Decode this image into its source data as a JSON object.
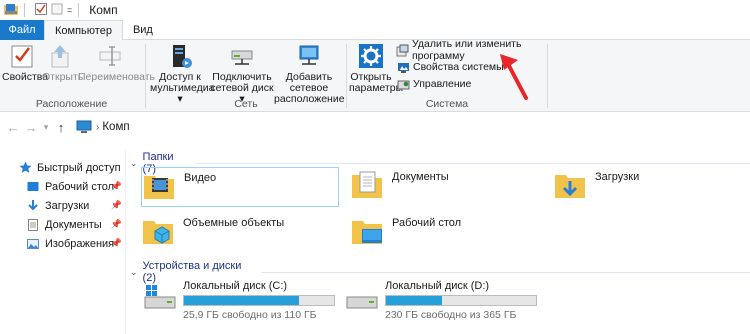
{
  "window": {
    "title": "Комп"
  },
  "tabs": [
    {
      "label": "Файл"
    },
    {
      "label": "Компьютер"
    },
    {
      "label": "Вид"
    }
  ],
  "ribbon": {
    "location_group": {
      "label": "Расположение",
      "properties": "Свойства",
      "open": "Открыть",
      "rename": "Переименовать"
    },
    "network_group": {
      "label": "Сеть",
      "media_access": [
        "Доступ к",
        "мультимедиа ▾"
      ],
      "map_drive": [
        "Подключить",
        "сетевой диск ▾"
      ],
      "add_location": [
        "Добавить сетевое",
        "расположение"
      ]
    },
    "system_group": {
      "label": "Система",
      "open_settings": [
        "Открыть",
        "параметры"
      ],
      "uninstall": "Удалить или изменить программу",
      "system_properties": "Свойства системы",
      "manage": "Управление"
    }
  },
  "address": {
    "crumb": "Комп"
  },
  "sidebar": {
    "items": [
      {
        "label": "Быстрый доступ",
        "pinned": false
      },
      {
        "label": "Рабочий стол",
        "pinned": true
      },
      {
        "label": "Загрузки",
        "pinned": true
      },
      {
        "label": "Документы",
        "pinned": true
      },
      {
        "label": "Изображения",
        "pinned": true
      }
    ]
  },
  "folders_section": {
    "title": "Папки (7)"
  },
  "folders": [
    {
      "name": "Видео"
    },
    {
      "name": "Документы"
    },
    {
      "name": "Загрузки"
    },
    {
      "name": "Объемные объекты"
    },
    {
      "name": "Рабочий стол"
    }
  ],
  "drives_section": {
    "title": "Устройства и диски (2)"
  },
  "drives": [
    {
      "name": "Локальный диск (C:)",
      "free": "25,9 ГБ свободно из 110 ГБ",
      "used_fraction": 0.765
    },
    {
      "name": "Локальный диск (D:)",
      "free": "230 ГБ свободно из 365 ГБ",
      "used_fraction": 0.37
    }
  ],
  "colors": {
    "accent": "#1979ca",
    "bar_fill": "#26a0da",
    "annotation": "#e8262a",
    "section_text": "#1e3287"
  }
}
